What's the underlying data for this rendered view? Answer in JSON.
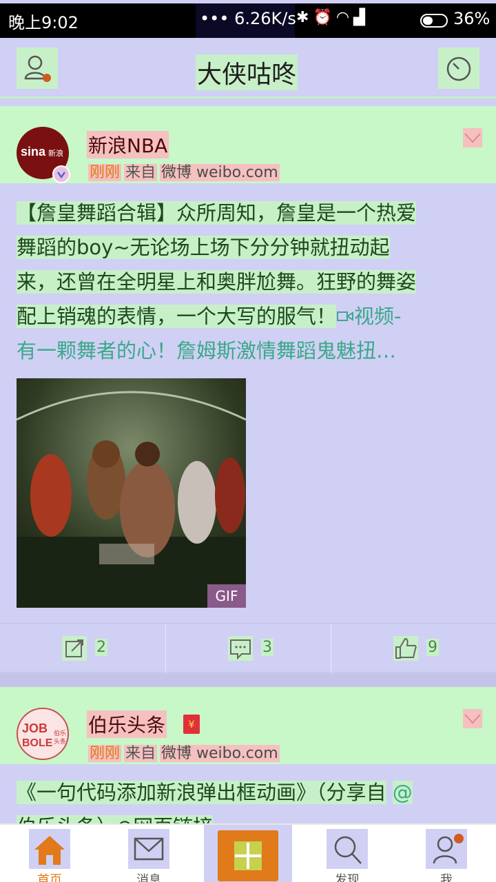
{
  "status_bar": {
    "time": "晚上9:02",
    "network_speed": "••• 6.26K/s",
    "battery_percent": "36%",
    "icons": [
      "bluetooth-icon",
      "alarm-icon",
      "wifi-icon",
      "signal-icon",
      "battery-icon"
    ]
  },
  "app_bar": {
    "title": "大侠咕咚",
    "left_icon": "profile-icon",
    "right_icon": "radar-icon",
    "accent": "#d25a1e"
  },
  "posts": [
    {
      "author": "新浪NBA",
      "avatar_text": "sina新浪",
      "verified": true,
      "time": "刚刚",
      "source_label": "来自",
      "source": "微博 weibo.com",
      "text_lines": [
        "【詹皇舞蹈合辑】众所周知，詹皇是一个热爱",
        "舞蹈的boy~无论场上场下分分钟就扭动起",
        "来，还曾在全明星上和奥胖尬舞。狂野的舞姿",
        "配上销魂的表情，一个大写的服气！"
      ],
      "video_link_head": "视频-",
      "video_link_tail": "有一颗舞者的心！詹姆斯激情舞蹈鬼魅扭…",
      "media_tag": "GIF",
      "reposts": "2",
      "comments": "3",
      "likes": "9"
    },
    {
      "author": "伯乐头条",
      "avatar_text": "JOBBOLE伯乐头条",
      "red_packet_badge": "¥",
      "time": "刚刚",
      "source_label": "来自",
      "source": "微博 weibo.com",
      "text_line_1": "《一句代码添加新浪弹出框动画》（分享自",
      "mention": "@",
      "text_line_2": "伯乐头条）⊘网页链接"
    }
  ],
  "tab_bar": {
    "tabs": [
      {
        "label": "首页",
        "icon": "home-icon",
        "active": true
      },
      {
        "label": "消息",
        "icon": "mail-icon",
        "active": false
      },
      {
        "label": "发现",
        "icon": "search-icon",
        "active": false
      },
      {
        "label": "我",
        "icon": "profile-icon",
        "active": false
      }
    ],
    "compose_icon": "plus-icon"
  }
}
